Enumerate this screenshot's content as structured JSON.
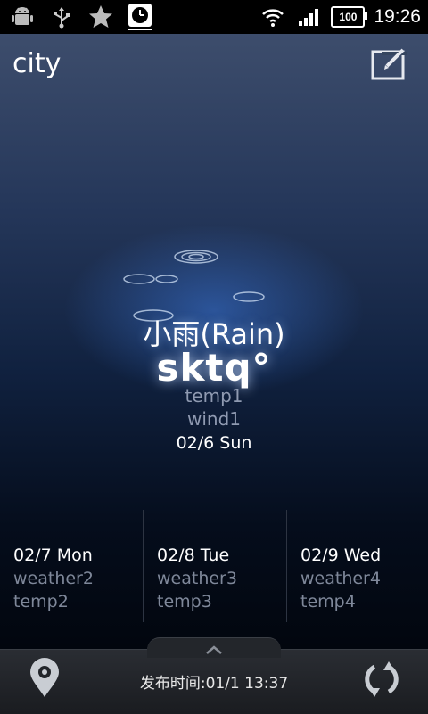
{
  "status_bar": {
    "icons": [
      "android-debug-icon",
      "usb-icon",
      "star-icon",
      "clock-widget-icon"
    ],
    "right_icons": [
      "wifi-icon",
      "signal-icon",
      "battery-icon"
    ],
    "battery": "100",
    "time": "19:26"
  },
  "header": {
    "city": "city",
    "edit_icon": "edit-icon"
  },
  "current": {
    "condition": "小雨(Rain)",
    "temperature": "sktq°",
    "temp_line": "temp1",
    "wind_line": "wind1",
    "date": "02/6 Sun"
  },
  "forecast": [
    {
      "date": "02/7 Mon",
      "weather": "weather2",
      "temp": "temp2"
    },
    {
      "date": "02/8 Tue",
      "weather": "weather3",
      "temp": "temp3"
    },
    {
      "date": "02/9 Wed",
      "weather": "weather4",
      "temp": "temp4"
    }
  ],
  "bottom_bar": {
    "location_icon": "location-pin-icon",
    "publish_time": "发布时间:01/1 13:37",
    "refresh_icon": "refresh-icon",
    "expand_icon": "chevron-up-icon"
  },
  "colors": {
    "background_top": "#3d4d6c",
    "background_bottom": "#02060e",
    "glow": "#3c78dc",
    "secondary_text": "#8f9ab1"
  }
}
